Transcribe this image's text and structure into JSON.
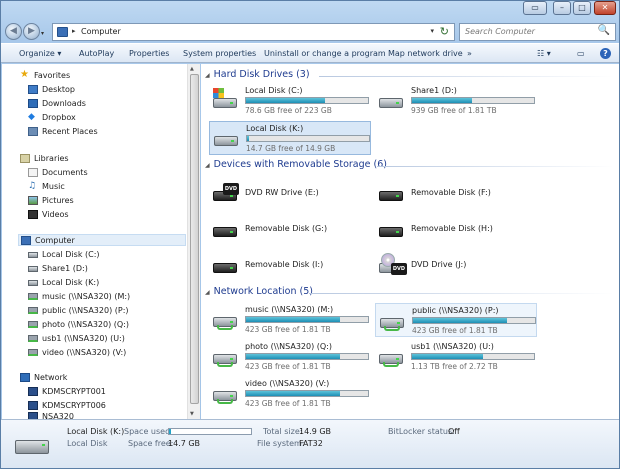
{
  "window": {
    "caption_buttons": [
      "▭",
      "–",
      "□",
      "✕"
    ]
  },
  "address": {
    "root_icon": "computer-icon",
    "separator": "▸",
    "path": "Computer",
    "dropdown": "▾",
    "refresh": "↻"
  },
  "search": {
    "placeholder": "Search Computer",
    "icon": "🔍"
  },
  "nav_buttons": {
    "back": "◀",
    "forward": "▶",
    "recent": "▾"
  },
  "commands": [
    "Organize ▾",
    "AutoPlay",
    "Properties",
    "System properties",
    "Uninstall or change a program",
    "Map network drive",
    "»"
  ],
  "toolbar_right": {
    "view": "☷ ▾",
    "preview": "▭",
    "help": "?"
  },
  "nav": {
    "favorites": {
      "label": "Favorites",
      "items": [
        "Desktop",
        "Downloads",
        "Dropbox",
        "Recent Places"
      ]
    },
    "libraries": {
      "label": "Libraries",
      "items": [
        "Documents",
        "Music",
        "Pictures",
        "Videos"
      ]
    },
    "computer": {
      "label": "Computer",
      "items": [
        "Local Disk (C:)",
        "Share1 (D:)",
        "Local Disk (K:)",
        "music (\\\\NSA320) (M:)",
        "public (\\\\NSA320) (P:)",
        "photo (\\\\NSA320) (Q:)",
        "usb1 (\\\\NSA320) (U:)",
        "video (\\\\NSA320) (V:)"
      ]
    },
    "network": {
      "label": "Network",
      "items": [
        "KDMSCRYPT001",
        "KDMSCRYPT006",
        "NSA320"
      ]
    }
  },
  "groups": {
    "hdd": {
      "label": "Hard Disk Drives (3)"
    },
    "removable": {
      "label": "Devices with Removable Storage (6)"
    },
    "network": {
      "label": "Network Location (5)"
    }
  },
  "drives": {
    "c": {
      "name": "Local Disk (C:)",
      "free": "78.6 GB free of 223 GB",
      "used_pct": 65
    },
    "d": {
      "name": "Share1 (D:)",
      "free": "939 GB free of 1.81 TB",
      "used_pct": 49
    },
    "k": {
      "name": "Local Disk (K:)",
      "free": "14.7 GB free of 14.9 GB",
      "used_pct": 2
    },
    "e": {
      "name": "DVD RW Drive (E:)",
      "badge": "DVD"
    },
    "f": {
      "name": "Removable Disk (F:)"
    },
    "g": {
      "name": "Removable Disk (G:)"
    },
    "h": {
      "name": "Removable Disk (H:)"
    },
    "i": {
      "name": "Removable Disk (I:)"
    },
    "j": {
      "name": "DVD Drive (J:)",
      "badge": "DVD"
    },
    "m": {
      "name": "music (\\\\NSA320) (M:)",
      "free": "423 GB free of 1.81 TB",
      "used_pct": 77
    },
    "p": {
      "name": "public (\\\\NSA320) (P:)",
      "free": "423 GB free of 1.81 TB",
      "used_pct": 77
    },
    "q": {
      "name": "photo (\\\\NSA320) (Q:)",
      "free": "423 GB free of 1.81 TB",
      "used_pct": 77
    },
    "u": {
      "name": "usb1 (\\\\NSA320) (U:)",
      "free": "1.13 TB free of 2.72 TB",
      "used_pct": 58
    },
    "v": {
      "name": "video (\\\\NSA320) (V:)",
      "free": "423 GB free of 1.81 TB",
      "used_pct": 77
    }
  },
  "details": {
    "name": "Local Disk (K:)",
    "type": "Local Disk",
    "space_used_label": "Space used:",
    "space_free_label": "Space free:",
    "space_free": "14.7 GB",
    "total_label": "Total size:",
    "total": "14.9 GB",
    "fs_label": "File system:",
    "fs": "FAT32",
    "bitlocker_label": "BitLocker status:",
    "bitlocker": "Off",
    "used_pct": 2
  },
  "colors": {
    "bar_fill": "#1d8fb5",
    "group_header": "#1e3b8f",
    "selection": "#d8e7f7"
  }
}
